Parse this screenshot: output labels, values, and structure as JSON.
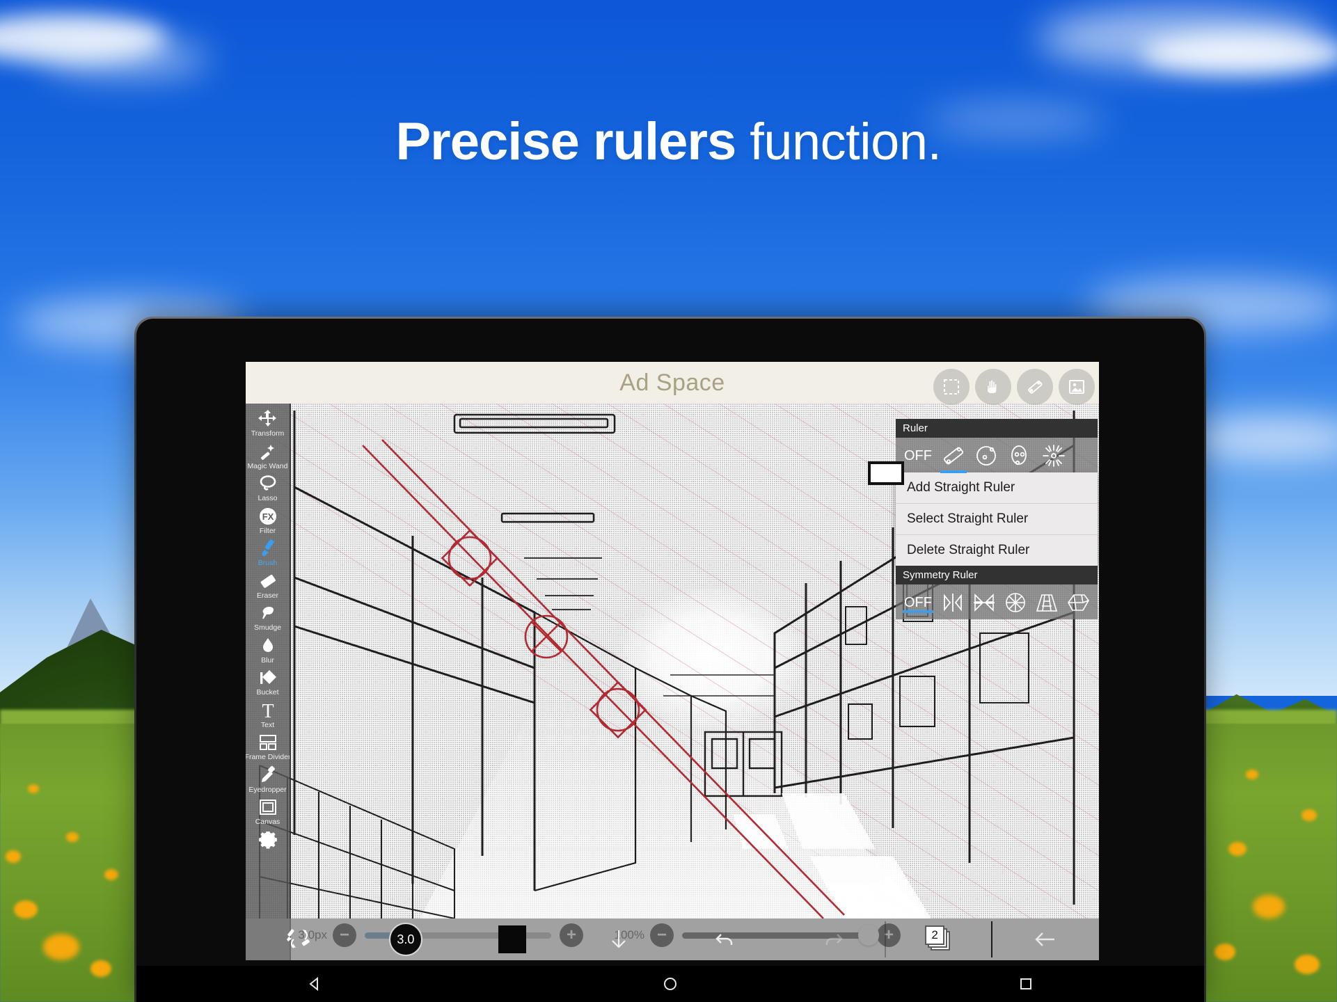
{
  "headline": {
    "bold": "Precise rulers",
    "light": " function."
  },
  "ad": {
    "label": "Ad Space"
  },
  "left_toolbar": {
    "tools": [
      {
        "label": "Transform",
        "icon": "move-arrows-icon",
        "active": false
      },
      {
        "label": "Magic Wand",
        "icon": "magic-wand-icon",
        "active": false
      },
      {
        "label": "Lasso",
        "icon": "lasso-icon",
        "active": false
      },
      {
        "label": "Filter",
        "icon": "fx-icon",
        "active": false
      },
      {
        "label": "Brush",
        "icon": "brush-icon",
        "active": true
      },
      {
        "label": "Eraser",
        "icon": "eraser-icon",
        "active": false
      },
      {
        "label": "Smudge",
        "icon": "smudge-finger-icon",
        "active": false
      },
      {
        "label": "Blur",
        "icon": "droplet-icon",
        "active": false
      },
      {
        "label": "Bucket",
        "icon": "paint-bucket-icon",
        "active": false
      },
      {
        "label": "Text",
        "icon": "text-t-icon",
        "active": false
      },
      {
        "label": "Frame Divider",
        "icon": "frame-divider-icon",
        "active": false
      },
      {
        "label": "Eyedropper",
        "icon": "eyedropper-icon",
        "active": false
      },
      {
        "label": "Canvas",
        "icon": "canvas-square-icon",
        "active": false
      }
    ],
    "settings_icon": "gear-icon"
  },
  "top_icons": [
    {
      "name": "selection-icon"
    },
    {
      "name": "hand-gesture-icon"
    },
    {
      "name": "ruler-icon"
    },
    {
      "name": "image-icon"
    }
  ],
  "ruler_panel": {
    "ruler_title": "Ruler",
    "ruler_off_label": "OFF",
    "ruler_modes": [
      {
        "name": "straight-ruler-icon",
        "selected": true
      },
      {
        "name": "circle-ruler-icon",
        "selected": false
      },
      {
        "name": "ellipse-ruler-icon",
        "selected": false
      },
      {
        "name": "radial-ruler-icon",
        "selected": false
      }
    ],
    "menu_items": [
      "Add Straight Ruler",
      "Select Straight Ruler",
      "Delete Straight Ruler"
    ],
    "symmetry_title": "Symmetry Ruler",
    "symmetry_off_label": "OFF",
    "symmetry_modes": [
      {
        "name": "mirror-vertical-icon",
        "selected": false
      },
      {
        "name": "mirror-quad-icon",
        "selected": false
      },
      {
        "name": "radial-symmetry-icon",
        "selected": false
      },
      {
        "name": "perspective-1pt-icon",
        "selected": false
      },
      {
        "name": "perspective-2pt-icon",
        "selected": false
      }
    ],
    "accent_color": "#3a9ef0",
    "header_bg": "#323232",
    "menu_bg": "#eceaea"
  },
  "sliders": {
    "brush_size": {
      "value": "3.0px",
      "minus": "−",
      "plus": "+",
      "percent": 22
    },
    "opacity": {
      "value": "100%",
      "minus": "−",
      "plus": "+",
      "percent": 100
    }
  },
  "bottom_bar": {
    "swap_icon": "brush-eraser-swap-icon",
    "brush_size_value": "3.0",
    "color_swatch": "#080808",
    "download_icon": "arrow-down-icon",
    "undo_icon": "undo-icon",
    "redo_icon": "redo-icon",
    "layers_icon": "layers-icon",
    "layers_count": "2",
    "back_icon": "arrow-left-icon"
  },
  "android_nav": [
    {
      "name": "nav-back-icon"
    },
    {
      "name": "nav-home-icon"
    },
    {
      "name": "nav-recents-icon"
    }
  ],
  "colors": {
    "sky_blue": "#1464dc",
    "ad_bg": "#f2efe6",
    "ad_text": "#a9a183",
    "ruler_red": "#b42a32",
    "active_tool": "#49a9f5"
  }
}
